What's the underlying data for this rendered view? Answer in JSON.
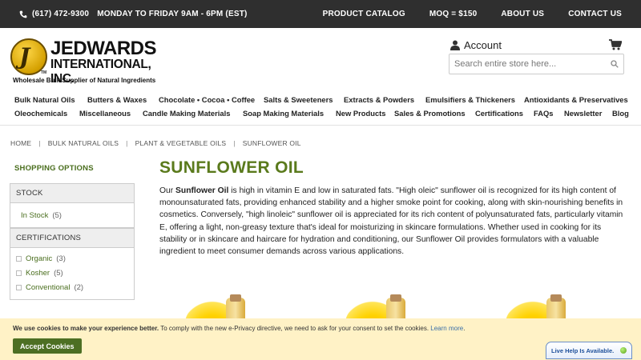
{
  "topbar": {
    "phone": "(617) 472-9300",
    "hours": "MONDAY TO FRIDAY 9AM - 6PM (EST)",
    "links": [
      "PRODUCT CATALOG",
      "MOQ = $150",
      "ABOUT US",
      "CONTACT US"
    ]
  },
  "logo": {
    "name": "JEDWARDS",
    "inc": "INTERNATIONAL, INC.",
    "tagline": "Wholesale Bulk Supplier of Natural Ingredients"
  },
  "header": {
    "account_label": "Account",
    "search_placeholder": "Search entire store here..."
  },
  "nav": {
    "row1": [
      "Bulk Natural Oils",
      "Butters & Waxes",
      "Chocolate • Cocoa • Coffee",
      "Salts & Sweeteners",
      "Extracts & Powders",
      "Emulsifiers & Thickeners",
      "Antioxidants & Preservatives"
    ],
    "row2": [
      "Oleochemicals",
      "Miscellaneous",
      "Candle Making Materials",
      "Soap Making Materials",
      "New Products",
      "Sales & Promotions",
      "Certifications",
      "FAQs",
      "Newsletter",
      "Blog"
    ]
  },
  "breadcrumb": [
    "HOME",
    "BULK NATURAL OILS",
    "PLANT & VEGETABLE OILS",
    "SUNFLOWER OIL"
  ],
  "sidebar": {
    "title": "SHOPPING OPTIONS",
    "stock": {
      "heading": "STOCK",
      "items": [
        {
          "label": "In Stock",
          "count": "(5)"
        }
      ]
    },
    "certifications": {
      "heading": "CERTIFICATIONS",
      "items": [
        {
          "label": "Organic",
          "count": "(3)"
        },
        {
          "label": "Kosher",
          "count": "(5)"
        },
        {
          "label": "Conventional",
          "count": "(2)"
        }
      ]
    }
  },
  "main": {
    "title": "SUNFLOWER OIL",
    "desc_prefix": "Our ",
    "desc_bold": "Sunflower Oil",
    "desc_rest": " is high in vitamin E and low in saturated fats. \"High oleic\" sunflower oil is recognized for its high content of monounsaturated fats, providing enhanced stability and a higher smoke point for cooking, along with skin-nourishing benefits in cosmetics. Conversely, \"high linoleic\" sunflower oil is appreciated for its rich content of polyunsaturated fats, particularly vitamin E, offering a light, non-greasy texture that's ideal for moisturizing in skincare formulations. Whether used in cooking for its stability or in skincare and haircare for hydration and conditioning, our Sunflower Oil provides formulators with a valuable ingredient to meet consumer demands across various applications."
  },
  "cookie": {
    "bold": "We use cookies to make your experience better.",
    "text": " To comply with the new e-Privacy directive, we need to ask for your consent to set the cookies. ",
    "learn": "Learn more",
    "button": "Accept Cookies"
  },
  "livehelp": {
    "label": "Live Help Is Available."
  },
  "colors": {
    "accent_green": "#5a7a1c",
    "topbar_bg": "#2f2f2f",
    "cookie_bg": "#fff2c6",
    "button_green": "#4d6f23"
  }
}
